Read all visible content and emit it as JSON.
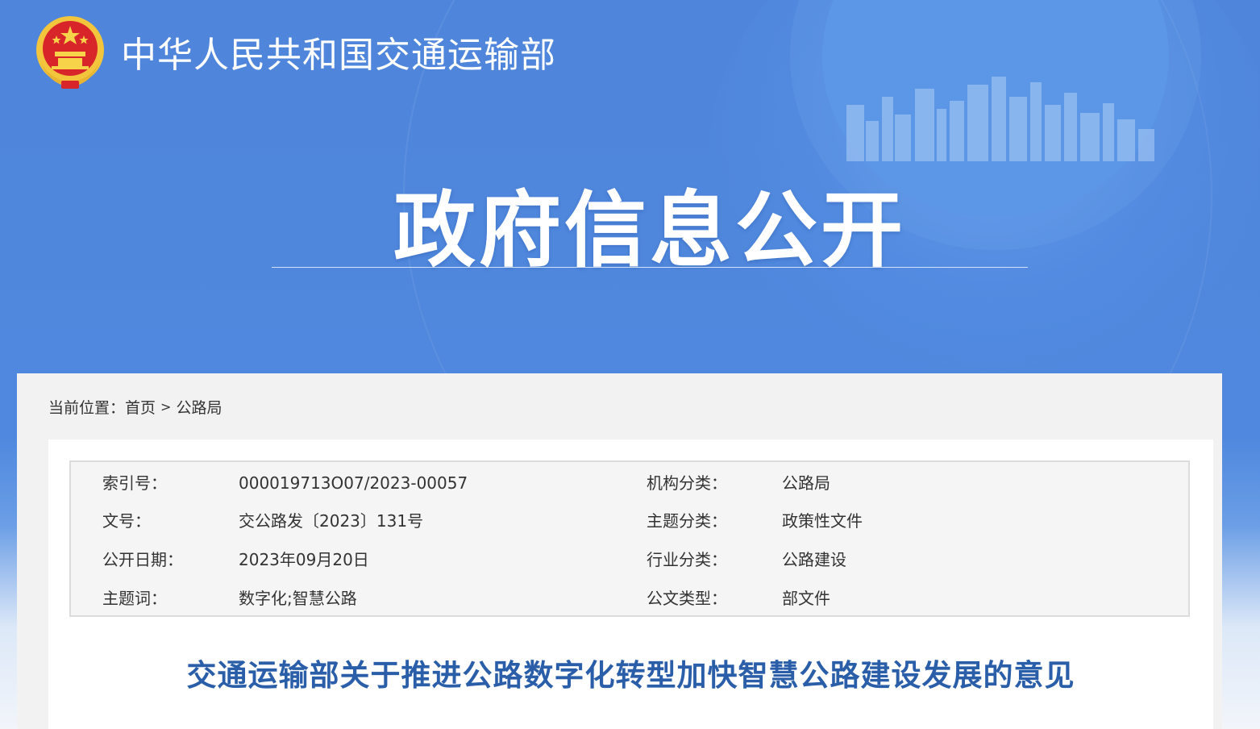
{
  "header": {
    "ministry_name": "中华人民共和国交通运输部",
    "section_title": "政府信息公开"
  },
  "breadcrumb": {
    "label": "当前位置：",
    "items": [
      "首页",
      "公路局"
    ],
    "separator": ">"
  },
  "metadata": [
    {
      "label": "索引号：",
      "value": "000019713O07/2023-00057",
      "label2": "机构分类：",
      "value2": "公路局"
    },
    {
      "label": "文号：",
      "value": "交公路发〔2023〕131号",
      "label2": "主题分类：",
      "value2": "政策性文件"
    },
    {
      "label": "公开日期：",
      "value": "2023年09月20日",
      "label2": "行业分类：",
      "value2": "公路建设"
    },
    {
      "label": "主题词：",
      "value": "数字化;智慧公路",
      "label2": "公文类型：",
      "value2": "部文件"
    }
  ],
  "document": {
    "title": "交通运输部关于推进公路数字化转型加快智慧公路建设发展的意见"
  },
  "colors": {
    "banner_blue": "#4f86db",
    "title_blue": "#2a5ea8",
    "panel_gray": "#f2f2f2"
  },
  "icons": {
    "emblem": "national-emblem-icon"
  }
}
